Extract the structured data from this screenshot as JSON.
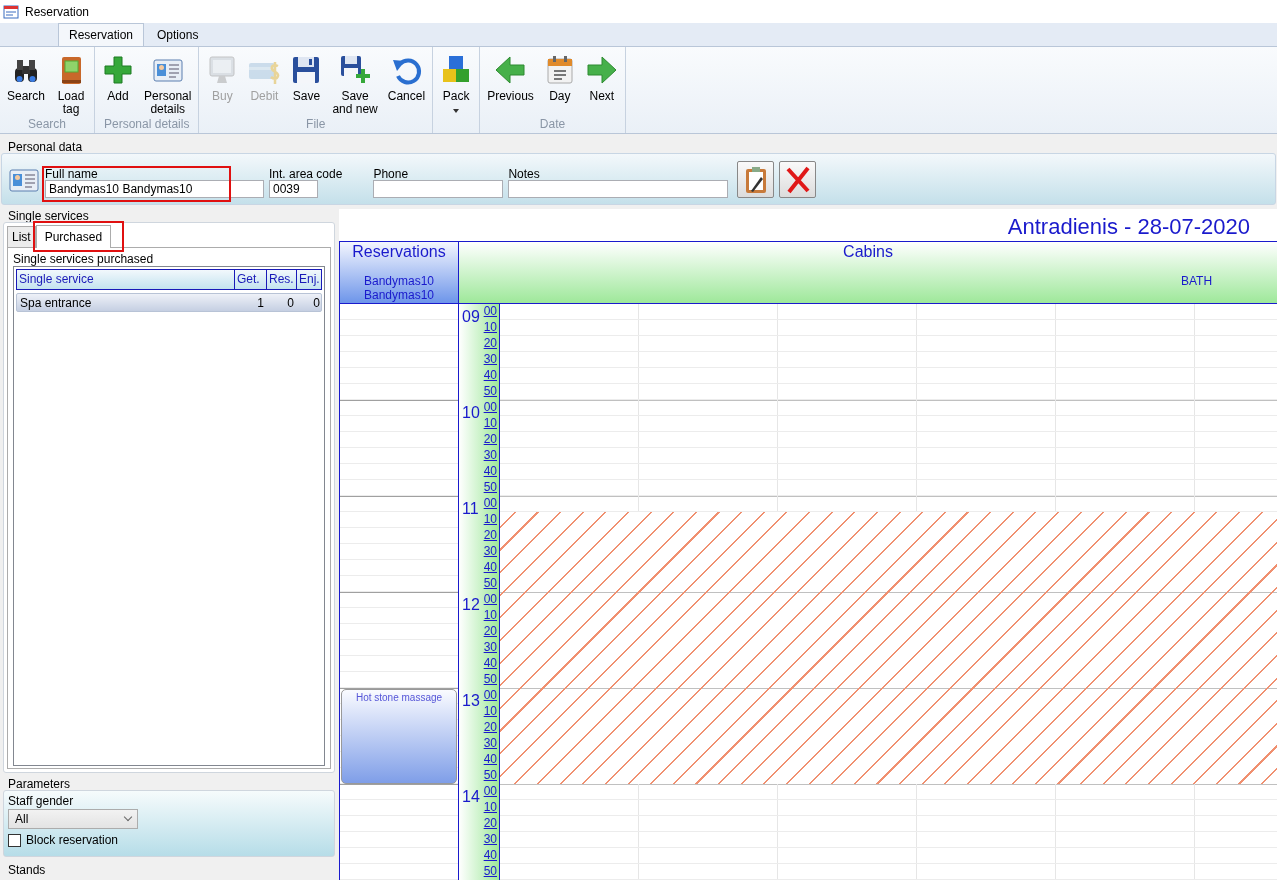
{
  "window": {
    "title": "Reservation"
  },
  "ribbon": {
    "tabs": [
      {
        "label": "Reservation",
        "selected": true
      },
      {
        "label": "Options",
        "selected": false
      }
    ],
    "groups": [
      {
        "label": "Search",
        "buttons": [
          {
            "label": "Search",
            "disabled": false
          },
          {
            "label": "Load\ntag",
            "disabled": false
          }
        ]
      },
      {
        "label": "Personal details",
        "buttons": [
          {
            "label": "Add",
            "disabled": false
          },
          {
            "label": "Personal\ndetails",
            "disabled": false
          }
        ]
      },
      {
        "label": "File",
        "buttons": [
          {
            "label": "Buy",
            "disabled": true
          },
          {
            "label": "Debit",
            "disabled": true
          },
          {
            "label": "Save",
            "disabled": false
          },
          {
            "label": "Save\nand new",
            "disabled": false
          },
          {
            "label": "Cancel",
            "disabled": false
          }
        ]
      },
      {
        "buttons": [
          {
            "label": "Pack",
            "disabled": false,
            "dropdown": true
          }
        ]
      },
      {
        "label": "Date",
        "buttons": [
          {
            "label": "Previous",
            "disabled": false
          },
          {
            "label": "Day",
            "disabled": false
          },
          {
            "label": "Next",
            "disabled": false
          }
        ]
      }
    ]
  },
  "personal": {
    "title": "Personal data",
    "fields": [
      {
        "label": "Full name",
        "value": "Bandymas10 Bandymas10",
        "highlighted": true
      },
      {
        "label": "Int. area code",
        "value": "0039",
        "highlighted": false
      },
      {
        "label": "Phone",
        "highlighted": false
      },
      {
        "label": "Notes",
        "highlighted": false
      }
    ]
  },
  "single_services": {
    "title": "Single services",
    "tabs": [
      {
        "label": "List",
        "selected": false,
        "highlighted": false
      },
      {
        "label": "Purchased",
        "selected": true,
        "highlighted": true
      }
    ],
    "list_title": "Single services purchased",
    "columns": [
      "Single service",
      "Get.",
      "Res.",
      "Enj."
    ],
    "rows": [
      {
        "cells": [
          "Spa entrance",
          "1",
          "0",
          "0"
        ],
        "selected": true
      }
    ]
  },
  "parameters": {
    "title": "Parameters",
    "staff_gender_label": "Staff gender",
    "staff_gender": "All",
    "block_reservation": {
      "label": "Block reservation",
      "checked": false
    }
  },
  "stands": {
    "title": "Stands"
  },
  "schedule": {
    "date": "Antradienis - 28-07-2020",
    "reservations_header": "Reservations",
    "client": "Bandymas10 Bandymas10",
    "cabins_header": "Cabins",
    "cabin": "BATH",
    "hours": [
      {
        "hour": "09",
        "slots": [
          {
            "minute": "00",
            "blocked": false
          },
          {
            "minute": "10",
            "blocked": false
          },
          {
            "minute": "20",
            "blocked": false
          },
          {
            "minute": "30",
            "blocked": false
          },
          {
            "minute": "40",
            "blocked": false
          },
          {
            "minute": "50",
            "blocked": false
          }
        ]
      },
      {
        "hour": "10",
        "slots": [
          {
            "minute": "00",
            "blocked": false
          },
          {
            "minute": "10",
            "blocked": false
          },
          {
            "minute": "20",
            "blocked": false
          },
          {
            "minute": "30",
            "blocked": false
          },
          {
            "minute": "40",
            "blocked": false
          },
          {
            "minute": "50",
            "blocked": false
          }
        ]
      },
      {
        "hour": "11",
        "slots": [
          {
            "minute": "00",
            "blocked": false
          },
          {
            "minute": "10",
            "blocked": true
          },
          {
            "minute": "20",
            "blocked": true
          },
          {
            "minute": "30",
            "blocked": true
          },
          {
            "minute": "40",
            "blocked": true
          },
          {
            "minute": "50",
            "blocked": true
          }
        ]
      },
      {
        "hour": "12",
        "slots": [
          {
            "minute": "00",
            "blocked": true
          },
          {
            "minute": "10",
            "blocked": true
          },
          {
            "minute": "20",
            "blocked": true
          },
          {
            "minute": "30",
            "blocked": true
          },
          {
            "minute": "40",
            "blocked": true
          },
          {
            "minute": "50",
            "blocked": true
          }
        ]
      },
      {
        "hour": "13",
        "reservation": "Hot stone massage",
        "slots": [
          {
            "minute": "00",
            "blocked": true
          },
          {
            "minute": "10",
            "blocked": true
          },
          {
            "minute": "20",
            "blocked": true
          },
          {
            "minute": "30",
            "blocked": true
          },
          {
            "minute": "40",
            "blocked": true
          },
          {
            "minute": "50",
            "blocked": true
          }
        ]
      },
      {
        "hour": "14",
        "slots": [
          {
            "minute": "00",
            "blocked": false
          },
          {
            "minute": "10",
            "blocked": false
          },
          {
            "minute": "20",
            "blocked": false
          },
          {
            "minute": "30",
            "blocked": false
          },
          {
            "minute": "40",
            "blocked": false
          },
          {
            "minute": "50",
            "blocked": false
          }
        ]
      }
    ]
  }
}
